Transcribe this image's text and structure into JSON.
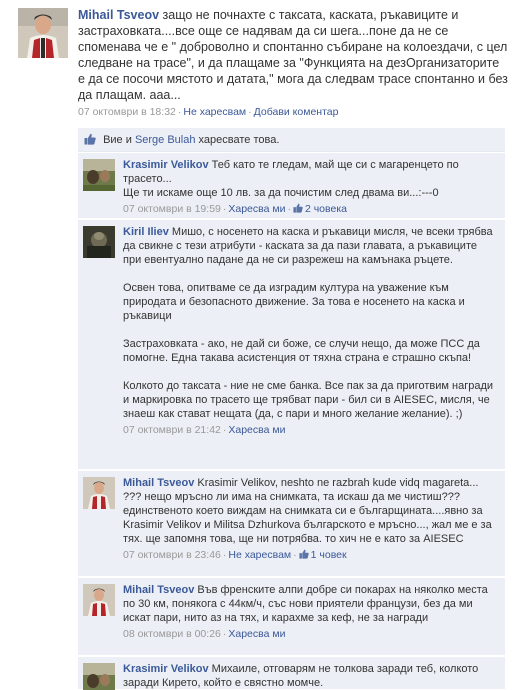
{
  "post": {
    "author": "Mihail Tsveov",
    "text": "защо не почнахте с таксата, каската, ръкавиците и застраховката....все още се надявам да си шега...поне да не се споменава че е \" доброволно и спонтанно събиране на колоездачи, с цел следване на трасе\", и да плащаме за \"Функцията на дезОрганизаторите е да се посочи мястото и датата,\" мога да следвам трасе спонтанно и без да плащам. ааа...",
    "time": "07 октомври в 18:32",
    "unlike_label": "Не харесвам",
    "comment_label": "Добави коментар"
  },
  "likes": {
    "prefix": "Вие и",
    "person": "Serge Bulah",
    "suffix": "харесвате това."
  },
  "comments": [
    {
      "author": "Krasimir Velikov",
      "text": "Теб като те гледам, май ще си с магаренцето по трасето...",
      "text2": "Ще ти искаме още 10 лв. за да почистим след двама ви...:---0",
      "time": "07 октомври в 19:59",
      "action": "Харесва ми",
      "likes": "2 човека"
    },
    {
      "author": "Kiril Iliev",
      "text": "Мишо, с носенето на каска и ръкавици мисля, че всеки трябва да свикне с тези атрибути - каската за да пази главата, а ръкавиците при евентуално падане да не си разрежеш на камънака ръцете.",
      "p2": "Освен това, опитваме се да изградим култура на уважение към природата и безопасното движение. За това е носенето на каска и ръкавици",
      "p3": "Застраховката - ако, не дай си боже, се случи нещо, да може ПСС да помогне. Една такава асистенция от тяхна страна е страшно скъпа!",
      "p4": "Колкото до таксата - ние не сме банка. Все пак за да приготвим награди и маркировка по трасето ще трябват пари - бил си в AIESEC, мисля, че знаеш как стават нещата (да, с пари и много желание желание). ;)",
      "time": "07 октомври в 21:42",
      "action": "Харесва ми"
    },
    {
      "author": "Mihail Tsveov",
      "text": "Krasimir Velikov, neshto ne razbrah kude vidq magareta... ??? нещо мръсно ли има на снимката, та искаш да ме чистиш??? единственото което виждам на снимката си е българщината....явно за Krasimir Velikov и Militsa Dzhurkova българското е мръсно..., жал ме е за тях. ще запомня това, ще ни потрябва. то хич не е като за AIESEC",
      "time": "07 октомври в 23:46",
      "action": "Не харесвам",
      "likes": "1 човек"
    },
    {
      "author": "Mihail Tsveov",
      "text": "Във френските алпи добре си покарах на няколко места по 30 км, понякога с 44км/ч, със нови приятели французи, без да ми искат пари, нито аз на тях, и карахме за кеф, не за награди",
      "time": "08 октомври в 00:26",
      "action": "Харесва ми"
    },
    {
      "author": "Krasimir Velikov",
      "text": "Михаиле, отговарям не толкова заради теб, колкото заради Кирето, който е свястно момче."
    }
  ],
  "colors": {
    "link": "#3b5998",
    "comment_bg": "#eceff5",
    "meta": "#999999"
  }
}
